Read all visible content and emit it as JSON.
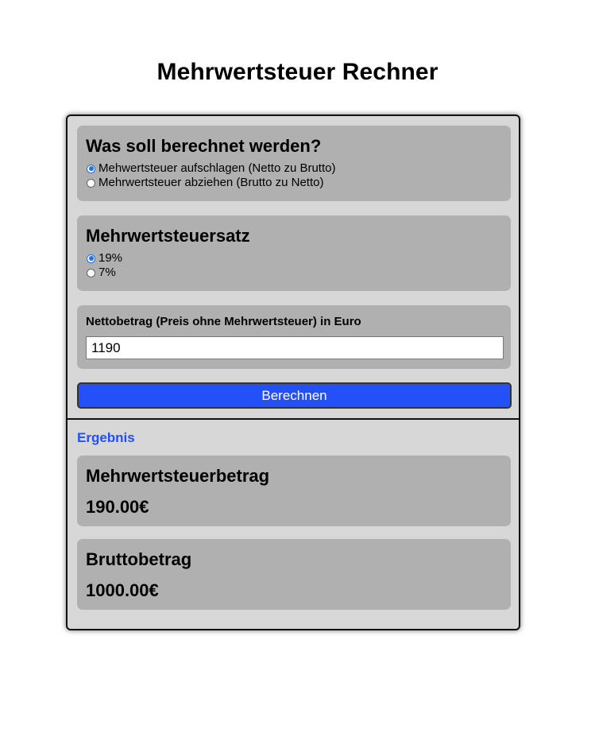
{
  "page": {
    "title": "Mehrwertsteuer Rechner"
  },
  "mode": {
    "heading": "Was soll berechnet werden?",
    "options": [
      {
        "label": "Mehwertsteuer aufschlagen (Netto zu Brutto)",
        "checked": true
      },
      {
        "label": "Mehrwertsteuer abziehen (Brutto zu Netto)",
        "checked": false
      }
    ]
  },
  "rate": {
    "heading": "Mehrwertsteuersatz",
    "options": [
      {
        "label": "19%",
        "checked": true
      },
      {
        "label": "7%",
        "checked": false
      }
    ]
  },
  "amount": {
    "label": "Nettobetrag (Preis ohne Mehrwertsteuer) in Euro",
    "value": "1190"
  },
  "actions": {
    "calculate_label": "Berechnen"
  },
  "result": {
    "heading": "Ergebnis",
    "vat": {
      "label": "Mehrwertsteuerbetrag",
      "value": "190.00€"
    },
    "gross": {
      "label": "Bruttobetrag",
      "value": "1000.00€"
    }
  },
  "colors": {
    "accent": "#2350f7",
    "panel": "#b0b0b0",
    "card": "#d7d7d7",
    "radio_checked": "#1f6fe5"
  }
}
